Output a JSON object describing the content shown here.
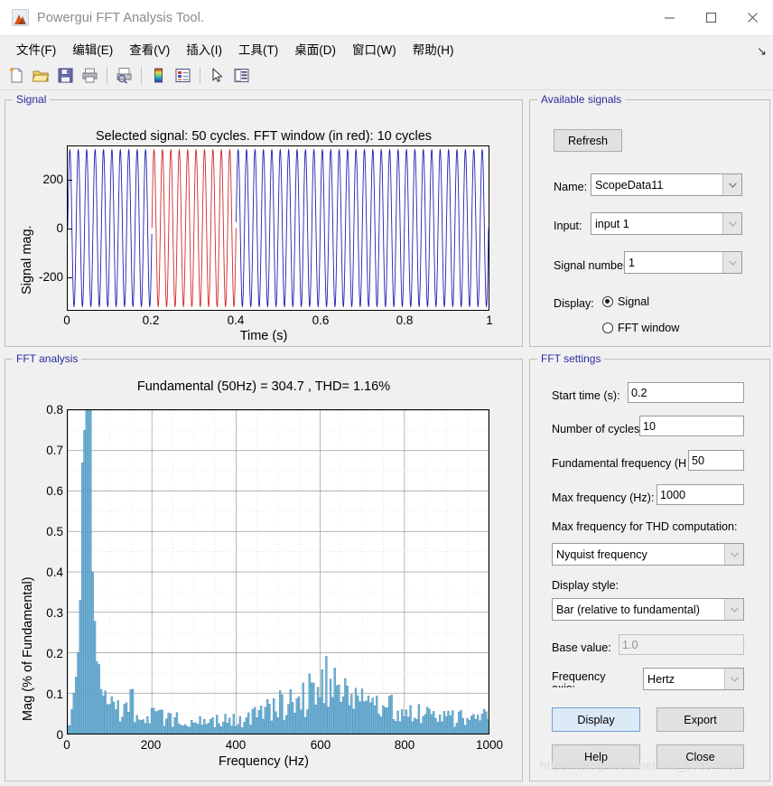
{
  "window": {
    "title": "Powergui FFT Analysis Tool.",
    "app_icon": "matlab-icon",
    "minimize": "–",
    "maximize": "□",
    "close": "✕"
  },
  "menubar": {
    "items": [
      {
        "label": "文件(F)",
        "name": "menu-file"
      },
      {
        "label": "编辑(E)",
        "name": "menu-edit"
      },
      {
        "label": "查看(V)",
        "name": "menu-view"
      },
      {
        "label": "插入(I)",
        "name": "menu-insert"
      },
      {
        "label": "工具(T)",
        "name": "menu-tools"
      },
      {
        "label": "桌面(D)",
        "name": "menu-desktop"
      },
      {
        "label": "窗口(W)",
        "name": "menu-window"
      },
      {
        "label": "帮助(H)",
        "name": "menu-help"
      }
    ],
    "overflow_arrow": "↘"
  },
  "toolbar": {
    "buttons": [
      {
        "name": "new-figure-icon"
      },
      {
        "name": "open-file-icon"
      },
      {
        "name": "save-figure-icon"
      },
      {
        "name": "print-figure-icon"
      },
      {
        "name": "print-preview-icon"
      },
      {
        "name": "colorbar-icon"
      },
      {
        "name": "legend-icon"
      },
      {
        "name": "pointer-icon"
      },
      {
        "name": "plot-browser-icon"
      }
    ]
  },
  "signal_panel": {
    "title": "Signal",
    "chart_title": "Selected signal: 50 cycles. FFT window (in red): 10 cycles",
    "xlabel": "Time (s)",
    "ylabel": "Signal mag.",
    "xticks": [
      "0",
      "0.2",
      "0.4",
      "0.6",
      "0.8",
      "1"
    ],
    "yticks": [
      "200",
      "0",
      "-200"
    ]
  },
  "fft_panel": {
    "title": "FFT analysis",
    "chart_title": "Fundamental (50Hz) = 304.7 , THD= 1.16%",
    "xlabel": "Frequency (Hz)",
    "ylabel": "Mag (% of Fundamental)",
    "xticks": [
      "0",
      "200",
      "400",
      "600",
      "800",
      "1000"
    ],
    "yticks": [
      "0.8",
      "0.7",
      "0.6",
      "0.5",
      "0.4",
      "0.3",
      "0.2",
      "0.1",
      "0"
    ]
  },
  "available_signals": {
    "title": "Available signals",
    "refresh_label": "Refresh",
    "name_label": "Name:",
    "name_value": "ScopeData11",
    "input_label": "Input:",
    "input_value": "input 1",
    "signal_number_label": "Signal number",
    "signal_number_value": "1",
    "display_label": "Display:",
    "radio_signal": "Signal",
    "radio_fft_window": "FFT window",
    "selected_display": "Signal"
  },
  "fft_settings": {
    "title": "FFT settings",
    "start_time_label": "Start time (s):",
    "start_time_value": "0.2",
    "cycles_label": "Number of cycles",
    "cycles_value": "10",
    "fundamental_label": "Fundamental frequency (H",
    "fundamental_value": "50",
    "max_freq_label": "Max frequency (Hz):",
    "max_freq_value": "1000",
    "thd_label": "Max frequency for THD computation:",
    "thd_value": "Nyquist frequency",
    "display_style_label": "Display style:",
    "display_style_value": "Bar (relative to fundamental)",
    "base_value_label": "Base value:",
    "base_value_value": "1.0",
    "freq_axis_label": "Frequency axis:",
    "freq_axis_value": "Hertz",
    "display_button": "Display",
    "export_button": "Export",
    "help_button": "Help",
    "close_button": "Close"
  },
  "watermark": "https://blog.csdn.net/m0_50854084",
  "colors": {
    "signal_blue": "#2020b0",
    "fft_window_red": "#d42a2a",
    "bar_fill": "#6fb3d8",
    "bar_edge": "#3a7fa8",
    "panel_title": "#2b2b9e",
    "accent_button": "#dce9f7"
  },
  "chart_data": [
    {
      "type": "line",
      "id": "signal-waveform",
      "title": "Selected signal: 50 cycles. FFT window (in red): 10 cycles",
      "xlabel": "Time (s)",
      "ylabel": "Signal mag.",
      "xlim": [
        0,
        1
      ],
      "ylim": [
        -311,
        311
      ],
      "xticks": [
        0,
        0.2,
        0.4,
        0.6,
        0.8,
        1
      ],
      "yticks": [
        -200,
        0,
        200
      ],
      "grid": false,
      "series": [
        {
          "name": "signal",
          "frequency_hz": 50,
          "amplitude": 305,
          "cycles": 50,
          "color": "#2020b0"
        },
        {
          "name": "fft-window",
          "color": "#d42a2a",
          "window_start_s": 0.2,
          "window_end_s": 0.4,
          "cycles": 10
        }
      ]
    },
    {
      "type": "bar",
      "id": "fft-spectrum",
      "title": "Fundamental (50Hz) = 304.7 , THD= 1.16%",
      "xlabel": "Frequency (Hz)",
      "ylabel": "Mag (% of Fundamental)",
      "xlim": [
        0,
        1000
      ],
      "ylim": [
        0,
        0.8
      ],
      "xticks": [
        0,
        200,
        400,
        600,
        800,
        1000
      ],
      "yticks": [
        0,
        0.1,
        0.2,
        0.3,
        0.4,
        0.5,
        0.6,
        0.7,
        0.8
      ],
      "grid": true,
      "fundamental_hz": 50,
      "fundamental_magnitude": 304.7,
      "thd_percent": 1.16,
      "note": "Fundamental bar at 50 Hz is clipped at the 0.8 axis top; surrounding skirt and broadband noise floor follow.",
      "x": [
        5,
        10,
        15,
        20,
        25,
        30,
        35,
        40,
        45,
        50,
        55,
        60,
        65,
        70,
        75,
        80,
        85,
        90,
        95,
        100,
        110,
        120,
        130,
        140,
        150,
        160,
        170,
        180,
        190,
        200,
        220,
        240,
        260,
        280,
        300,
        320,
        340,
        360,
        380,
        400,
        420,
        440,
        460,
        480,
        500,
        520,
        540,
        560,
        580,
        600,
        620,
        640,
        660,
        680,
        700,
        720,
        740,
        760,
        780,
        800,
        820,
        840,
        860,
        880,
        900,
        920,
        940,
        960,
        980,
        1000
      ],
      "values": [
        0.02,
        0.06,
        0.1,
        0.14,
        0.2,
        0.33,
        0.67,
        0.75,
        0.82,
        0.82,
        0.75,
        0.4,
        0.27,
        0.21,
        0.15,
        0.12,
        0.1,
        0.09,
        0.08,
        0.07,
        0.06,
        0.055,
        0.05,
        0.05,
        0.09,
        0.05,
        0.045,
        0.045,
        0.04,
        0.04,
        0.04,
        0.035,
        0.035,
        0.035,
        0.035,
        0.03,
        0.035,
        0.03,
        0.035,
        0.03,
        0.035,
        0.04,
        0.05,
        0.06,
        0.07,
        0.06,
        0.09,
        0.08,
        0.1,
        0.15,
        0.11,
        0.14,
        0.09,
        0.08,
        0.07,
        0.06,
        0.07,
        0.1,
        0.06,
        0.05,
        0.045,
        0.05,
        0.04,
        0.035,
        0.04,
        0.035,
        0.04,
        0.035,
        0.04,
        0.05
      ]
    }
  ]
}
